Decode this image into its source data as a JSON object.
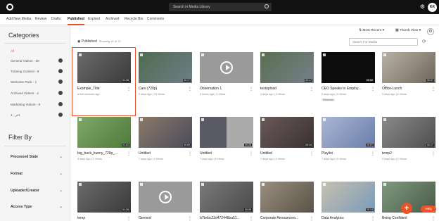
{
  "topbar": {
    "search_placeholder": "Search in Media Library",
    "avatar_initials": "KK"
  },
  "tabs": [
    "Add New Media",
    "Review",
    "Drafts",
    "Published",
    "Expired",
    "Archived",
    "Recycle Bin",
    "Comments"
  ],
  "active_tab": "Published",
  "sidebar": {
    "categories_title": "Categories",
    "all_label": "All",
    "items": [
      "General Videos - 38",
      "Training Content - 8",
      "Welcome Pack - 1",
      "Archived Videos - 4",
      "Marketing Videos - 9",
      "1 - انتر"
    ],
    "filter_title": "Filter By",
    "filters": [
      "Processed State",
      "Format",
      "Uploader/Creator",
      "Access Type"
    ]
  },
  "toolbar": {
    "published_label": "Published",
    "showing": "Showing 24 of 72",
    "sort_label": "Most Recent",
    "view_label": "Thumb View",
    "search_placeholder": "Search For Media"
  },
  "cards": [
    {
      "title": "Example_Title",
      "meta": "a few seconds ago",
      "duration": "01:28",
      "badge": ""
    },
    {
      "title": "Cars (720p)",
      "meta": "5 days ago | 20 Views",
      "duration": "00:17",
      "badge": ""
    },
    {
      "title": "Observation 1",
      "meta": "5 hours ago | 3 Views",
      "duration": "",
      "badge": ""
    },
    {
      "title": "testupload",
      "meta": "4 days ago | 3 Views",
      "duration": "00:17",
      "badge": ""
    },
    {
      "title": "CEO Speaks to Employ...",
      "meta": "5 days ago | 8 Views",
      "duration": "00:52",
      "badge": "Restricted"
    },
    {
      "title": "Office-Lunch",
      "meta": "5 days ago | 6 Views",
      "duration": "00:07",
      "badge": ""
    },
    {
      "title": "big_buck_bunny_720p_...",
      "meta": "5 days ago | 3 Views",
      "duration": "01:02",
      "badge": ""
    },
    {
      "title": "Untitled",
      "meta": "7 days ago | 4 Views",
      "duration": "00:09",
      "badge": ""
    },
    {
      "title": "Untitled",
      "meta": "7 days ago | 5 Views",
      "duration": "00:28",
      "badge": ""
    },
    {
      "title": "Untitled",
      "meta": "7 days ago | 5 Views",
      "duration": "00:14",
      "badge": ""
    },
    {
      "title": "Playlist",
      "meta": "7 days ago | 5 Views",
      "duration": "00:57",
      "badge": ""
    },
    {
      "title": "temp2",
      "meta": "9 days ago | 3 Views",
      "duration": "00:17",
      "badge": ""
    },
    {
      "title": "temp",
      "meta": "",
      "duration": "01:28",
      "badge": ""
    },
    {
      "title": "General",
      "meta": "",
      "duration": "",
      "badge": ""
    },
    {
      "title": "b7bebc23d472446ba51...",
      "meta": "",
      "duration": "00:09",
      "badge": ""
    },
    {
      "title": "Corporate Announcem...",
      "meta": "",
      "duration": "",
      "badge": ""
    },
    {
      "title": "Data Analytics",
      "meta": "",
      "duration": "00:14",
      "badge": ""
    },
    {
      "title": "Being Confident",
      "meta": "",
      "duration": "",
      "badge": ""
    }
  ],
  "colors": {
    "accent": "#e8542a",
    "topbar": "#111111"
  },
  "fab_label": "+",
  "help_label": "Help"
}
